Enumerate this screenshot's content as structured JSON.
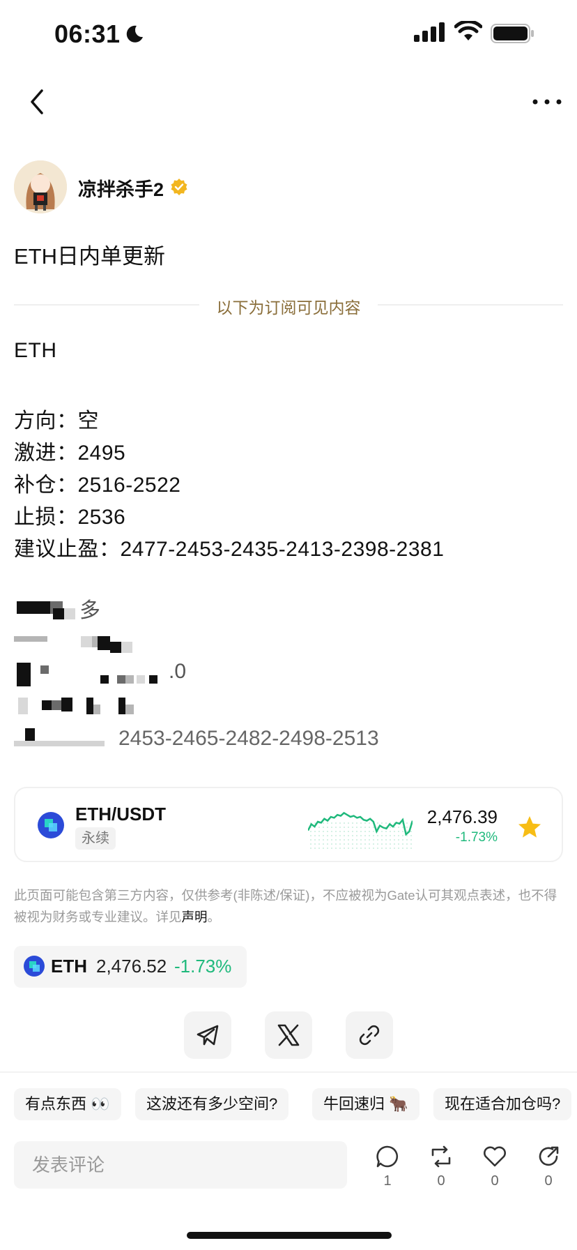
{
  "status_bar": {
    "time": "06:31"
  },
  "author": {
    "name": "凉拌杀手2"
  },
  "post": {
    "title": "ETH日内单更新",
    "subscriber_divider": "以下为订阅可见内容",
    "lines": [
      "ETH",
      "方向：空",
      "激进：2495",
      "补仓：2516-2522",
      "止损：2536",
      "建议止盈：2477-2453-2435-2413-2398-2381"
    ],
    "blurred_fragments": {
      "line1": "多",
      "line3": ".0",
      "line5": "2453-2465-2482-2498-2513"
    }
  },
  "market_card": {
    "pair": "ETH/USDT",
    "tag": "永续",
    "price": "2,476.39",
    "change": "-1.73%",
    "sparkline": [
      0.42,
      0.55,
      0.5,
      0.6,
      0.58,
      0.66,
      0.62,
      0.7,
      0.68,
      0.74,
      0.72,
      0.78,
      0.74,
      0.7,
      0.72,
      0.68,
      0.7,
      0.64,
      0.62,
      0.66,
      0.6,
      0.4,
      0.52,
      0.48,
      0.46,
      0.55,
      0.5,
      0.58,
      0.56,
      0.64,
      0.34,
      0.4,
      0.62
    ]
  },
  "disclaimer": {
    "text": "此页面可能包含第三方内容，仅供参考(非陈述/保证)，不应被视为Gate认可其观点表述，也不得被视为财务或专业建议。详见",
    "link": "声明",
    "suffix": "。"
  },
  "eth_chip": {
    "symbol": "ETH",
    "price": "2,476.52",
    "change": "-1.73%"
  },
  "quick_replies": [
    "有点东西 👀",
    "这波还有多少空间?",
    "牛回速归 🐂",
    "现在适合加仓吗?"
  ],
  "comment": {
    "placeholder": "发表评论",
    "counts": {
      "comments": "1",
      "reposts": "0",
      "likes": "0",
      "shares": "0"
    }
  },
  "colors": {
    "accent_green": "#1fb97c",
    "divider_text": "#8a6e3a",
    "verified": "#f2b620",
    "star": "#f7bd15"
  }
}
